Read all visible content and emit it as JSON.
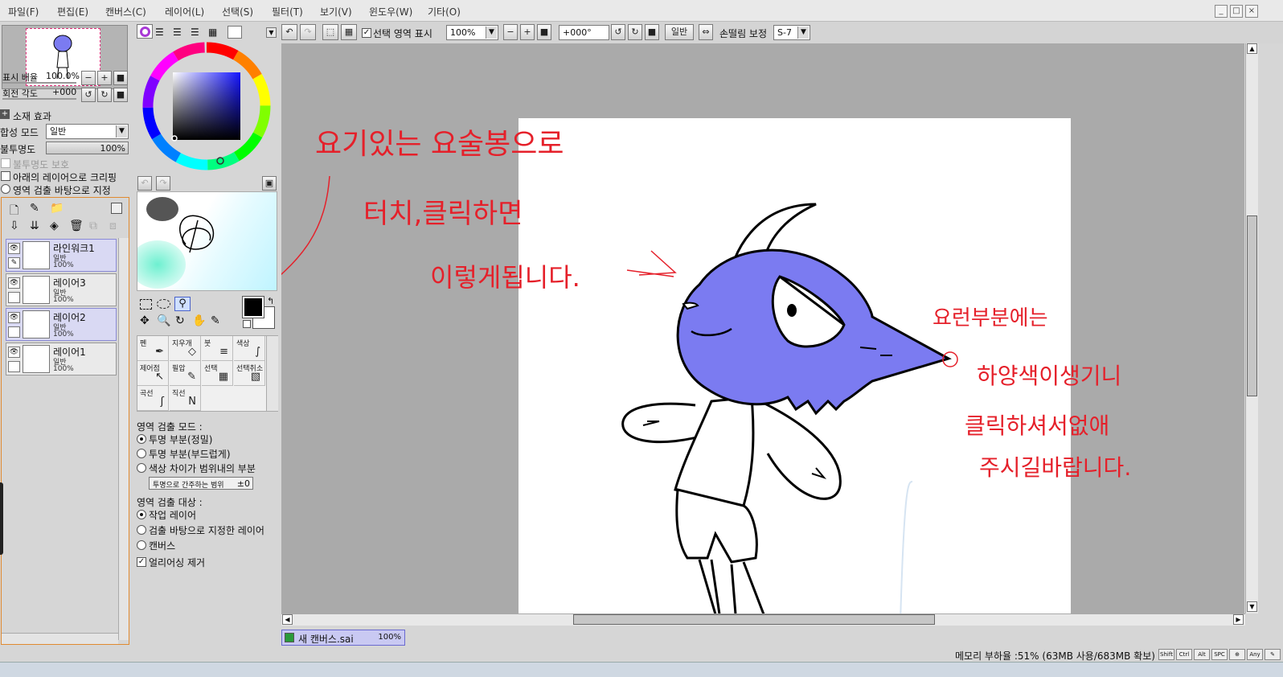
{
  "menu": {
    "items": [
      "파일(F)",
      "편집(E)",
      "캔버스(C)",
      "레이어(L)",
      "선택(S)",
      "필터(T)",
      "보기(V)",
      "윈도우(W)",
      "기타(O)"
    ]
  },
  "window_controls": {
    "minimize": "_",
    "restore": "□",
    "close": "×"
  },
  "navigator": {
    "zoom_label": "표시 배율",
    "zoom_value": "100.0%",
    "angle_label": "회전 각도",
    "angle_value": "+000"
  },
  "layer_props": {
    "material_effect": "소재 효과",
    "blend_label": "합성 모드",
    "blend_value": "일반",
    "opacity_label": "불투명도",
    "opacity_value": "100%",
    "protect_opacity": "불투명도 보호",
    "clip_label": "아래의 레이어으로 크리핑",
    "source_label": "영역 검출 바탕으로 지정"
  },
  "layers": [
    {
      "name": "라인워크1",
      "mode": "일반",
      "opacity": "100%",
      "selected": true,
      "eye": "👁",
      "lock": "✎"
    },
    {
      "name": "레이어3",
      "mode": "일반",
      "opacity": "100%",
      "selected": false,
      "eye": "👁",
      "lock": ""
    },
    {
      "name": "레이어2",
      "mode": "일반",
      "opacity": "100%",
      "selected": true,
      "eye": "👁",
      "lock": ""
    },
    {
      "name": "레이어1",
      "mode": "일반",
      "opacity": "100%",
      "selected": false,
      "eye": "👁",
      "lock": ""
    }
  ],
  "tools": [
    {
      "label": "펜",
      "icon": "✒"
    },
    {
      "label": "지우개",
      "icon": "◇"
    },
    {
      "label": "붓",
      "icon": "≡"
    },
    {
      "label": "색상",
      "icon": "∫"
    },
    {
      "label": "제어점",
      "icon": "↖"
    },
    {
      "label": "필압",
      "icon": "✎"
    },
    {
      "label": "선택",
      "icon": "▦"
    },
    {
      "label": "선택취소",
      "icon": "▧"
    },
    {
      "label": "곡선",
      "icon": "ʃ"
    },
    {
      "label": "직선",
      "icon": "N"
    }
  ],
  "detection": {
    "mode_title": "영역 검출 모드 :",
    "mode_options": [
      "투명 부분(정밀)",
      "투명 부분(부드럽게)",
      "색상 차이가 범위내의 부분"
    ],
    "range_label": "투명으로 간주하는 범위",
    "range_value": "±0",
    "target_title": "영역 검출 대상 :",
    "target_options": [
      "작업 레이어",
      "검출 바탕으로 지정한 레이어",
      "캔버스"
    ],
    "antialias_label": "얼리어싱 제거"
  },
  "toolbar": {
    "show_selection_label": "선택 영역 표시",
    "zoom_value": "100%",
    "angle_value": "+000°",
    "normal_label": "일반",
    "stabilizer_label": "손떨림 보정",
    "stabilizer_value": "S-7"
  },
  "annotations": {
    "line1": "요기있는 요술봉으로",
    "line2": "터치,클릭하면",
    "line3": "이렇게됩니다.",
    "line4": "요런부분에는",
    "line5": "하양색이생기니",
    "line6": "클릭하셔서없애",
    "line7": "주시길바랍니다."
  },
  "tab": {
    "name": "새 캔버스.sai",
    "zoom": "100%"
  },
  "status": {
    "memory": "메모리 부하율 :51% (63MB 사용/683MB 확보)",
    "keys": [
      "Shift",
      "Ctrl",
      "Alt",
      "SPC",
      "⊕",
      "Any",
      "✎"
    ]
  },
  "colors": {
    "primary": "#000000",
    "secondary": "#ffffff",
    "character_fill": "#7b7bf1",
    "annotation": "#e5202a",
    "canvas_bg": "#aaaaaa"
  }
}
